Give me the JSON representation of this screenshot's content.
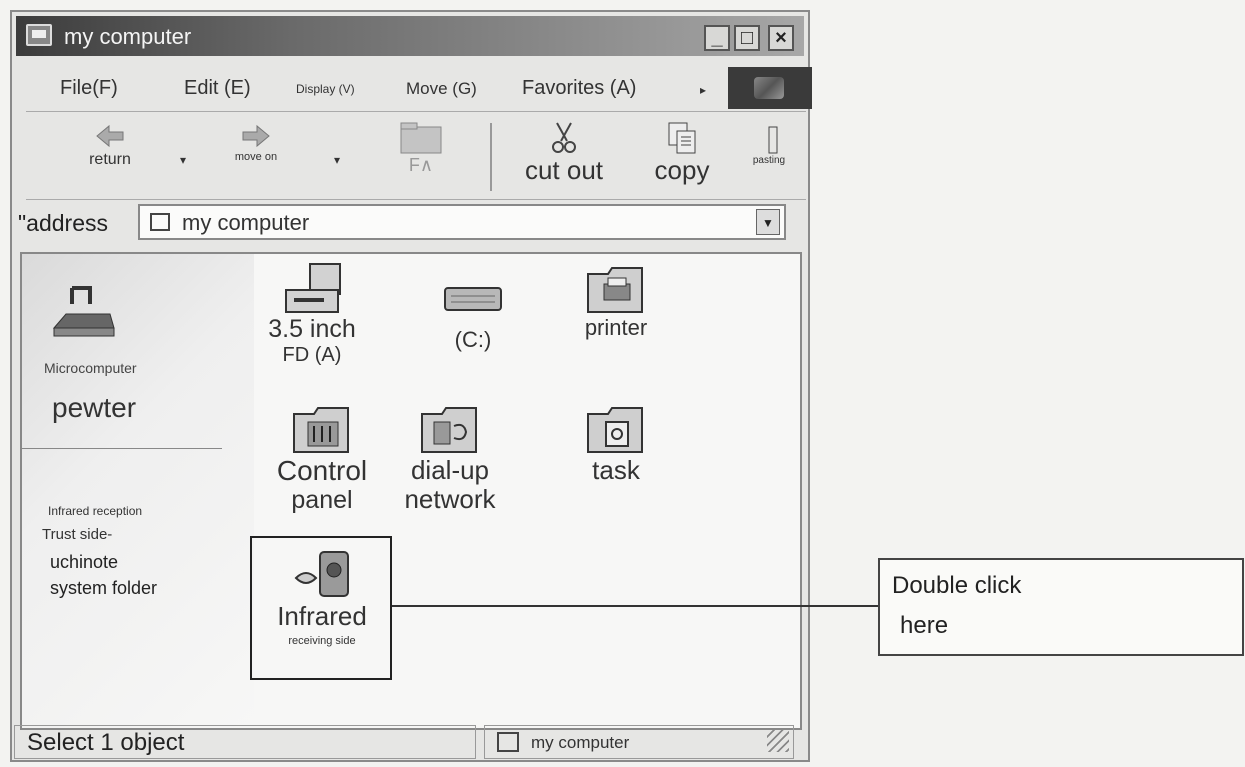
{
  "window": {
    "title": "my computer",
    "controls": {
      "minimize": "_",
      "maximize": "□",
      "close": "×"
    }
  },
  "menu": {
    "items": [
      "File(F)",
      "Edit (E)",
      "Display (V)",
      "Move (G)",
      "Favorites (A)"
    ],
    "more": "▸"
  },
  "toolbar": {
    "back_label": "return",
    "forward_label": "move on",
    "up_label": "F∧",
    "cut_label": "cut out",
    "copy_label": "copy",
    "paste_label": "pasting"
  },
  "address": {
    "label": "\"address",
    "value": "my computer"
  },
  "left_pane": {
    "subtitle": "Microcomputer",
    "name": "pewter",
    "info_1": "Infrared reception",
    "info_2": "Trust side-",
    "info_3": "uchinote",
    "info_4": "system folder"
  },
  "items": [
    {
      "label_1": "3.5 inch",
      "label_2": "FD (A)",
      "icon": "floppy-drive-icon"
    },
    {
      "label_1": "(C:)",
      "label_2": "",
      "icon": "hard-drive-icon"
    },
    {
      "label_1": "printer",
      "label_2": "",
      "icon": "printer-folder-icon"
    },
    {
      "label_1": "Control",
      "label_2": "panel",
      "icon": "control-panel-folder-icon"
    },
    {
      "label_1": "dial-up",
      "label_2": "network",
      "icon": "dialup-network-folder-icon"
    },
    {
      "label_1": "task",
      "label_2": "",
      "icon": "task-folder-icon"
    },
    {
      "label_1": "Infrared",
      "label_2": "receiving side",
      "icon": "infrared-icon"
    }
  ],
  "callout": {
    "line_1": "Double click",
    "line_2": "here"
  },
  "status": {
    "left": "Select 1 object",
    "right": "my computer"
  }
}
